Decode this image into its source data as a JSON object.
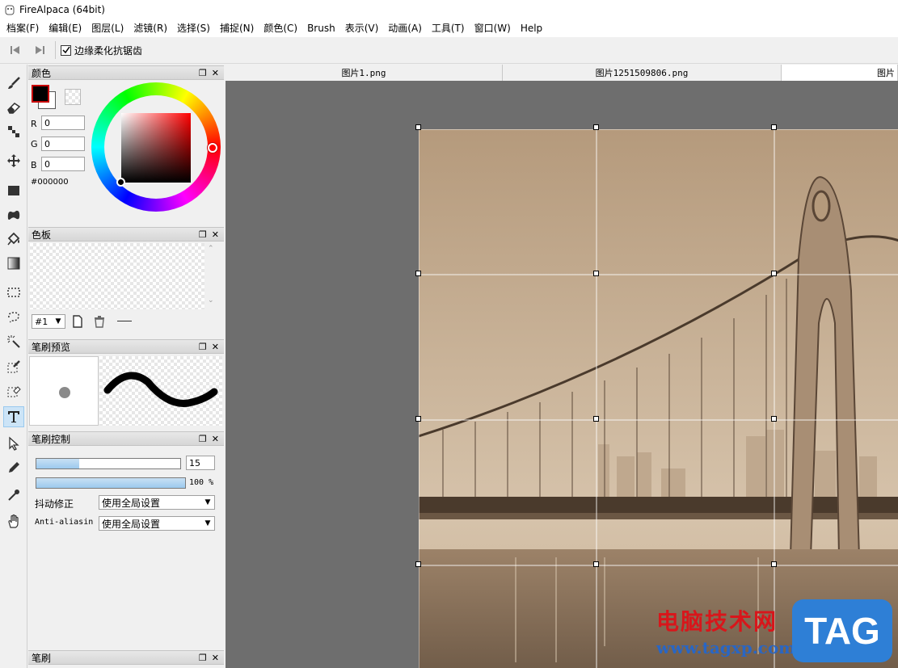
{
  "window": {
    "title": "FireAlpaca (64bit)"
  },
  "menu": [
    "档案(F)",
    "编辑(E)",
    "图层(L)",
    "滤镜(R)",
    "选择(S)",
    "捕捉(N)",
    "颜色(C)",
    "Brush",
    "表示(V)",
    "动画(A)",
    "工具(T)",
    "窗口(W)",
    "Help"
  ],
  "options": {
    "antialias_label": "边缘柔化抗锯齿",
    "antialias_checked": true
  },
  "tools": [
    "brush-tool",
    "eraser-tool",
    "dot-tool",
    "move-tool",
    "fill-rect-tool",
    "fill-shape-tool",
    "bucket-tool",
    "gradient-tool",
    "select-rect-tool",
    "lasso-tool",
    "magic-wand-tool",
    "select-pen-tool",
    "select-eraser-tool",
    "text-tool",
    "operation-tool",
    "pen-tool",
    "eyedropper-tool",
    "hand-tool"
  ],
  "color_panel": {
    "title": "颜色",
    "r_label": "R",
    "g_label": "G",
    "b_label": "B",
    "r": "0",
    "g": "0",
    "b": "0",
    "hex": "#000000"
  },
  "palette_panel": {
    "title": "色板",
    "select_value": "#1"
  },
  "brush_preview_panel": {
    "title": "笔刷预览"
  },
  "brush_control_panel": {
    "title": "笔刷控制",
    "size_value": "15",
    "opacity_text": "100 %",
    "size_fraction": 0.3,
    "opacity_fraction": 1.0,
    "stabilizer_label": "抖动修正",
    "stabilizer_value": "使用全局设置",
    "antialias_label": "Anti-aliasin",
    "antialias_value": "使用全局设置"
  },
  "brush_panel": {
    "title": "笔刷"
  },
  "tabs": [
    "图片1.png",
    "图片1251509806.png",
    "图片"
  ],
  "watermark": {
    "line1": "电脑技术网",
    "line2": "www.tagxp.com",
    "badge": "TAG"
  },
  "colors": {
    "canvas_bg": "#6e6e6e",
    "sepia": "#b89f84",
    "accent_blue": "#2e7fd6"
  }
}
